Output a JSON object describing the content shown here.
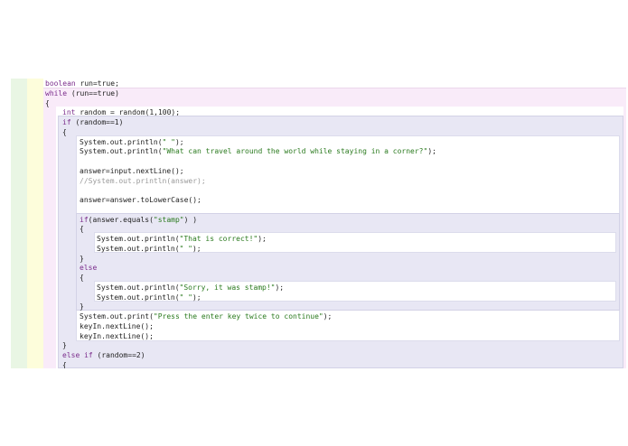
{
  "editor": {
    "lines": [
      {
        "parts": [
          {
            "t": "boolean",
            "k": "kw"
          },
          {
            "t": " run=true;"
          }
        ]
      },
      {
        "parts": [
          {
            "t": "while",
            "k": "kw"
          },
          {
            "t": " (run==true)"
          }
        ]
      },
      {
        "parts": [
          {
            "t": "{"
          }
        ]
      },
      {
        "parts": [
          {
            "t": "int",
            "k": "kw"
          },
          {
            "t": " random = random(1,100);"
          }
        ]
      },
      {
        "parts": [
          {
            "t": "if",
            "k": "kw"
          },
          {
            "t": " (random==1)"
          }
        ]
      },
      {
        "parts": [
          {
            "t": "{"
          }
        ]
      },
      {
        "parts": [
          {
            "t": "System.out.println("
          },
          {
            "t": "\" \"",
            "k": "str"
          },
          {
            "t": ");"
          }
        ]
      },
      {
        "parts": [
          {
            "t": "System.out.println("
          },
          {
            "t": "\"What can travel around the world while staying in a corner?\"",
            "k": "str"
          },
          {
            "t": ");"
          }
        ]
      },
      {
        "parts": []
      },
      {
        "parts": [
          {
            "t": "answer=input.nextLine();"
          }
        ]
      },
      {
        "parts": [
          {
            "t": "//System.out.println(answer);",
            "k": "cm"
          }
        ]
      },
      {
        "parts": []
      },
      {
        "parts": [
          {
            "t": "answer=answer.toLowerCase();"
          }
        ]
      },
      {
        "parts": []
      },
      {
        "parts": [
          {
            "t": "if",
            "k": "kw"
          },
          {
            "t": "(answer.equals("
          },
          {
            "t": "\"stamp\"",
            "k": "str"
          },
          {
            "t": ") )"
          }
        ]
      },
      {
        "parts": [
          {
            "t": "{"
          }
        ]
      },
      {
        "parts": [
          {
            "t": "System.out.println("
          },
          {
            "t": "\"That is correct!\"",
            "k": "str"
          },
          {
            "t": ");"
          }
        ]
      },
      {
        "parts": [
          {
            "t": "System.out.println("
          },
          {
            "t": "\" \"",
            "k": "str"
          },
          {
            "t": ");"
          }
        ]
      },
      {
        "parts": [
          {
            "t": "}"
          }
        ]
      },
      {
        "parts": [
          {
            "t": "else",
            "k": "kw"
          }
        ]
      },
      {
        "parts": [
          {
            "t": "{"
          }
        ]
      },
      {
        "parts": [
          {
            "t": "System.out.println("
          },
          {
            "t": "\"Sorry, it was stamp!\"",
            "k": "str"
          },
          {
            "t": ");"
          }
        ]
      },
      {
        "parts": [
          {
            "t": "System.out.println("
          },
          {
            "t": "\" \"",
            "k": "str"
          },
          {
            "t": ");"
          }
        ]
      },
      {
        "parts": [
          {
            "t": "}"
          }
        ]
      },
      {
        "parts": [
          {
            "t": "System.out.print("
          },
          {
            "t": "\"Press the enter key twice to continue\"",
            "k": "str"
          },
          {
            "t": ");"
          }
        ]
      },
      {
        "parts": [
          {
            "t": "keyIn.nextLine();"
          }
        ]
      },
      {
        "parts": [
          {
            "t": "keyIn.nextLine();"
          }
        ]
      },
      {
        "parts": [
          {
            "t": "}"
          }
        ]
      },
      {
        "parts": [
          {
            "t": "else if",
            "k": "kw"
          },
          {
            "t": " (random==2)"
          }
        ]
      },
      {
        "parts": [
          {
            "t": "{"
          }
        ]
      }
    ]
  }
}
